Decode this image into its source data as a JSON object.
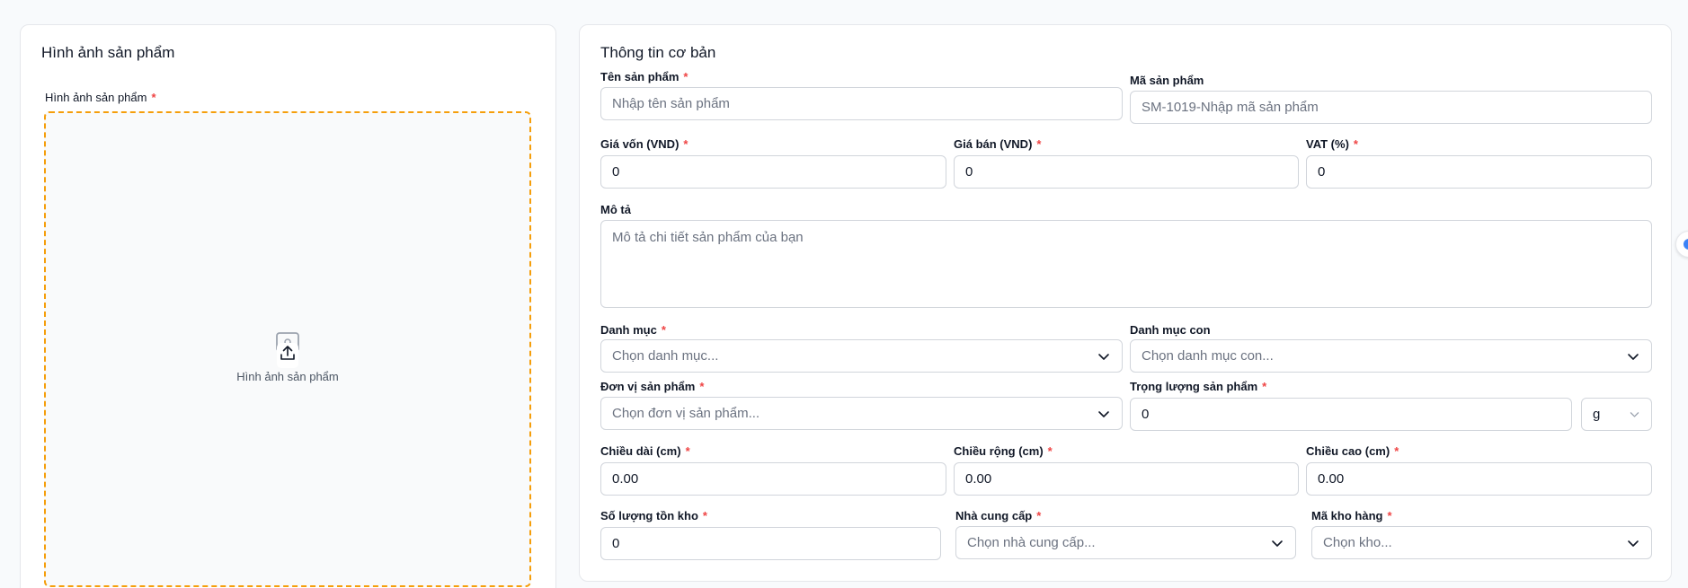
{
  "images_card": {
    "title": "Hình ảnh sản phẩm",
    "field_label": "Hình ảnh sản phẩm",
    "required_mark": "*",
    "dropzone_text": "Hình ảnh sản phẩm",
    "dropzone_icon": "image-upload-icon",
    "dropzone_border_color": "#f59e0b"
  },
  "basic_card": {
    "title": "Thông tin cơ bản",
    "fields": {
      "name": {
        "label": "Tên sản phẩm",
        "required": "*",
        "value": "",
        "placeholder": "Nhập tên sản phẩm"
      },
      "sku": {
        "label": "Mã sản phẩm",
        "value": "",
        "placeholder": "SM-1019-Nhập mã sản phẩm"
      },
      "cost_price": {
        "label": "Giá vốn (VND)",
        "required": "*",
        "value": "0"
      },
      "sale_price": {
        "label": "Giá bán (VND)",
        "required": "*",
        "value": "0"
      },
      "vat": {
        "label": "VAT (%)",
        "required": "*",
        "value": "0"
      },
      "description": {
        "label": "Mô tả",
        "value": "",
        "placeholder": "Mô tả chi tiết sản phẩm của bạn"
      },
      "category": {
        "label": "Danh mục",
        "required": "*",
        "selected": "Chọn danh mục..."
      },
      "subcategory": {
        "label": "Danh mục con",
        "selected": "Chọn danh mục con..."
      },
      "unit": {
        "label": "Đơn vị sản phẩm",
        "required": "*",
        "selected": "Chọn đơn vị sản phẩm..."
      },
      "weight": {
        "label": "Trọng lượng sản phẩm",
        "required": "*",
        "value": "0",
        "unit_selected": "g"
      },
      "length": {
        "label": "Chiều dài (cm)",
        "required": "*",
        "value": "0.00"
      },
      "width": {
        "label": "Chiều rộng (cm)",
        "required": "*",
        "value": "0.00"
      },
      "height": {
        "label": "Chiều cao (cm)",
        "required": "*",
        "value": "0.00"
      },
      "stock": {
        "label": "Số lượng tồn kho",
        "required": "*",
        "value": "0"
      },
      "supplier": {
        "label": "Nhà cung cấp",
        "required": "*",
        "selected": "Chọn nhà cung cấp..."
      },
      "warehouse": {
        "label": "Mã kho hàng",
        "required": "*",
        "selected": "Chọn kho..."
      }
    }
  },
  "colors": {
    "required": "#ef4444",
    "border": "#d1d5db",
    "page_background": "#f8fafc"
  }
}
